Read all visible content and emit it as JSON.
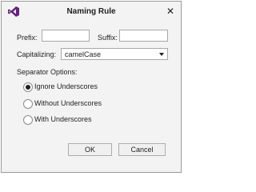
{
  "window": {
    "title": "Naming Rule",
    "close_glyph": "✕"
  },
  "app_icon": {
    "name": "visual-studio-icon",
    "color": "#68217a"
  },
  "prefix": {
    "label": "Prefix:",
    "value": ""
  },
  "suffix": {
    "label": "Suffix:",
    "value": ""
  },
  "capitalizing": {
    "label": "Capitalizing:",
    "selected": "camelCase"
  },
  "separator": {
    "label": "Separator Options:",
    "options": [
      {
        "label": "Ignore Underscores",
        "selected": true
      },
      {
        "label": "Without Underscores",
        "selected": false
      },
      {
        "label": "With Underscores",
        "selected": false
      }
    ]
  },
  "buttons": {
    "ok": "OK",
    "cancel": "Cancel"
  }
}
